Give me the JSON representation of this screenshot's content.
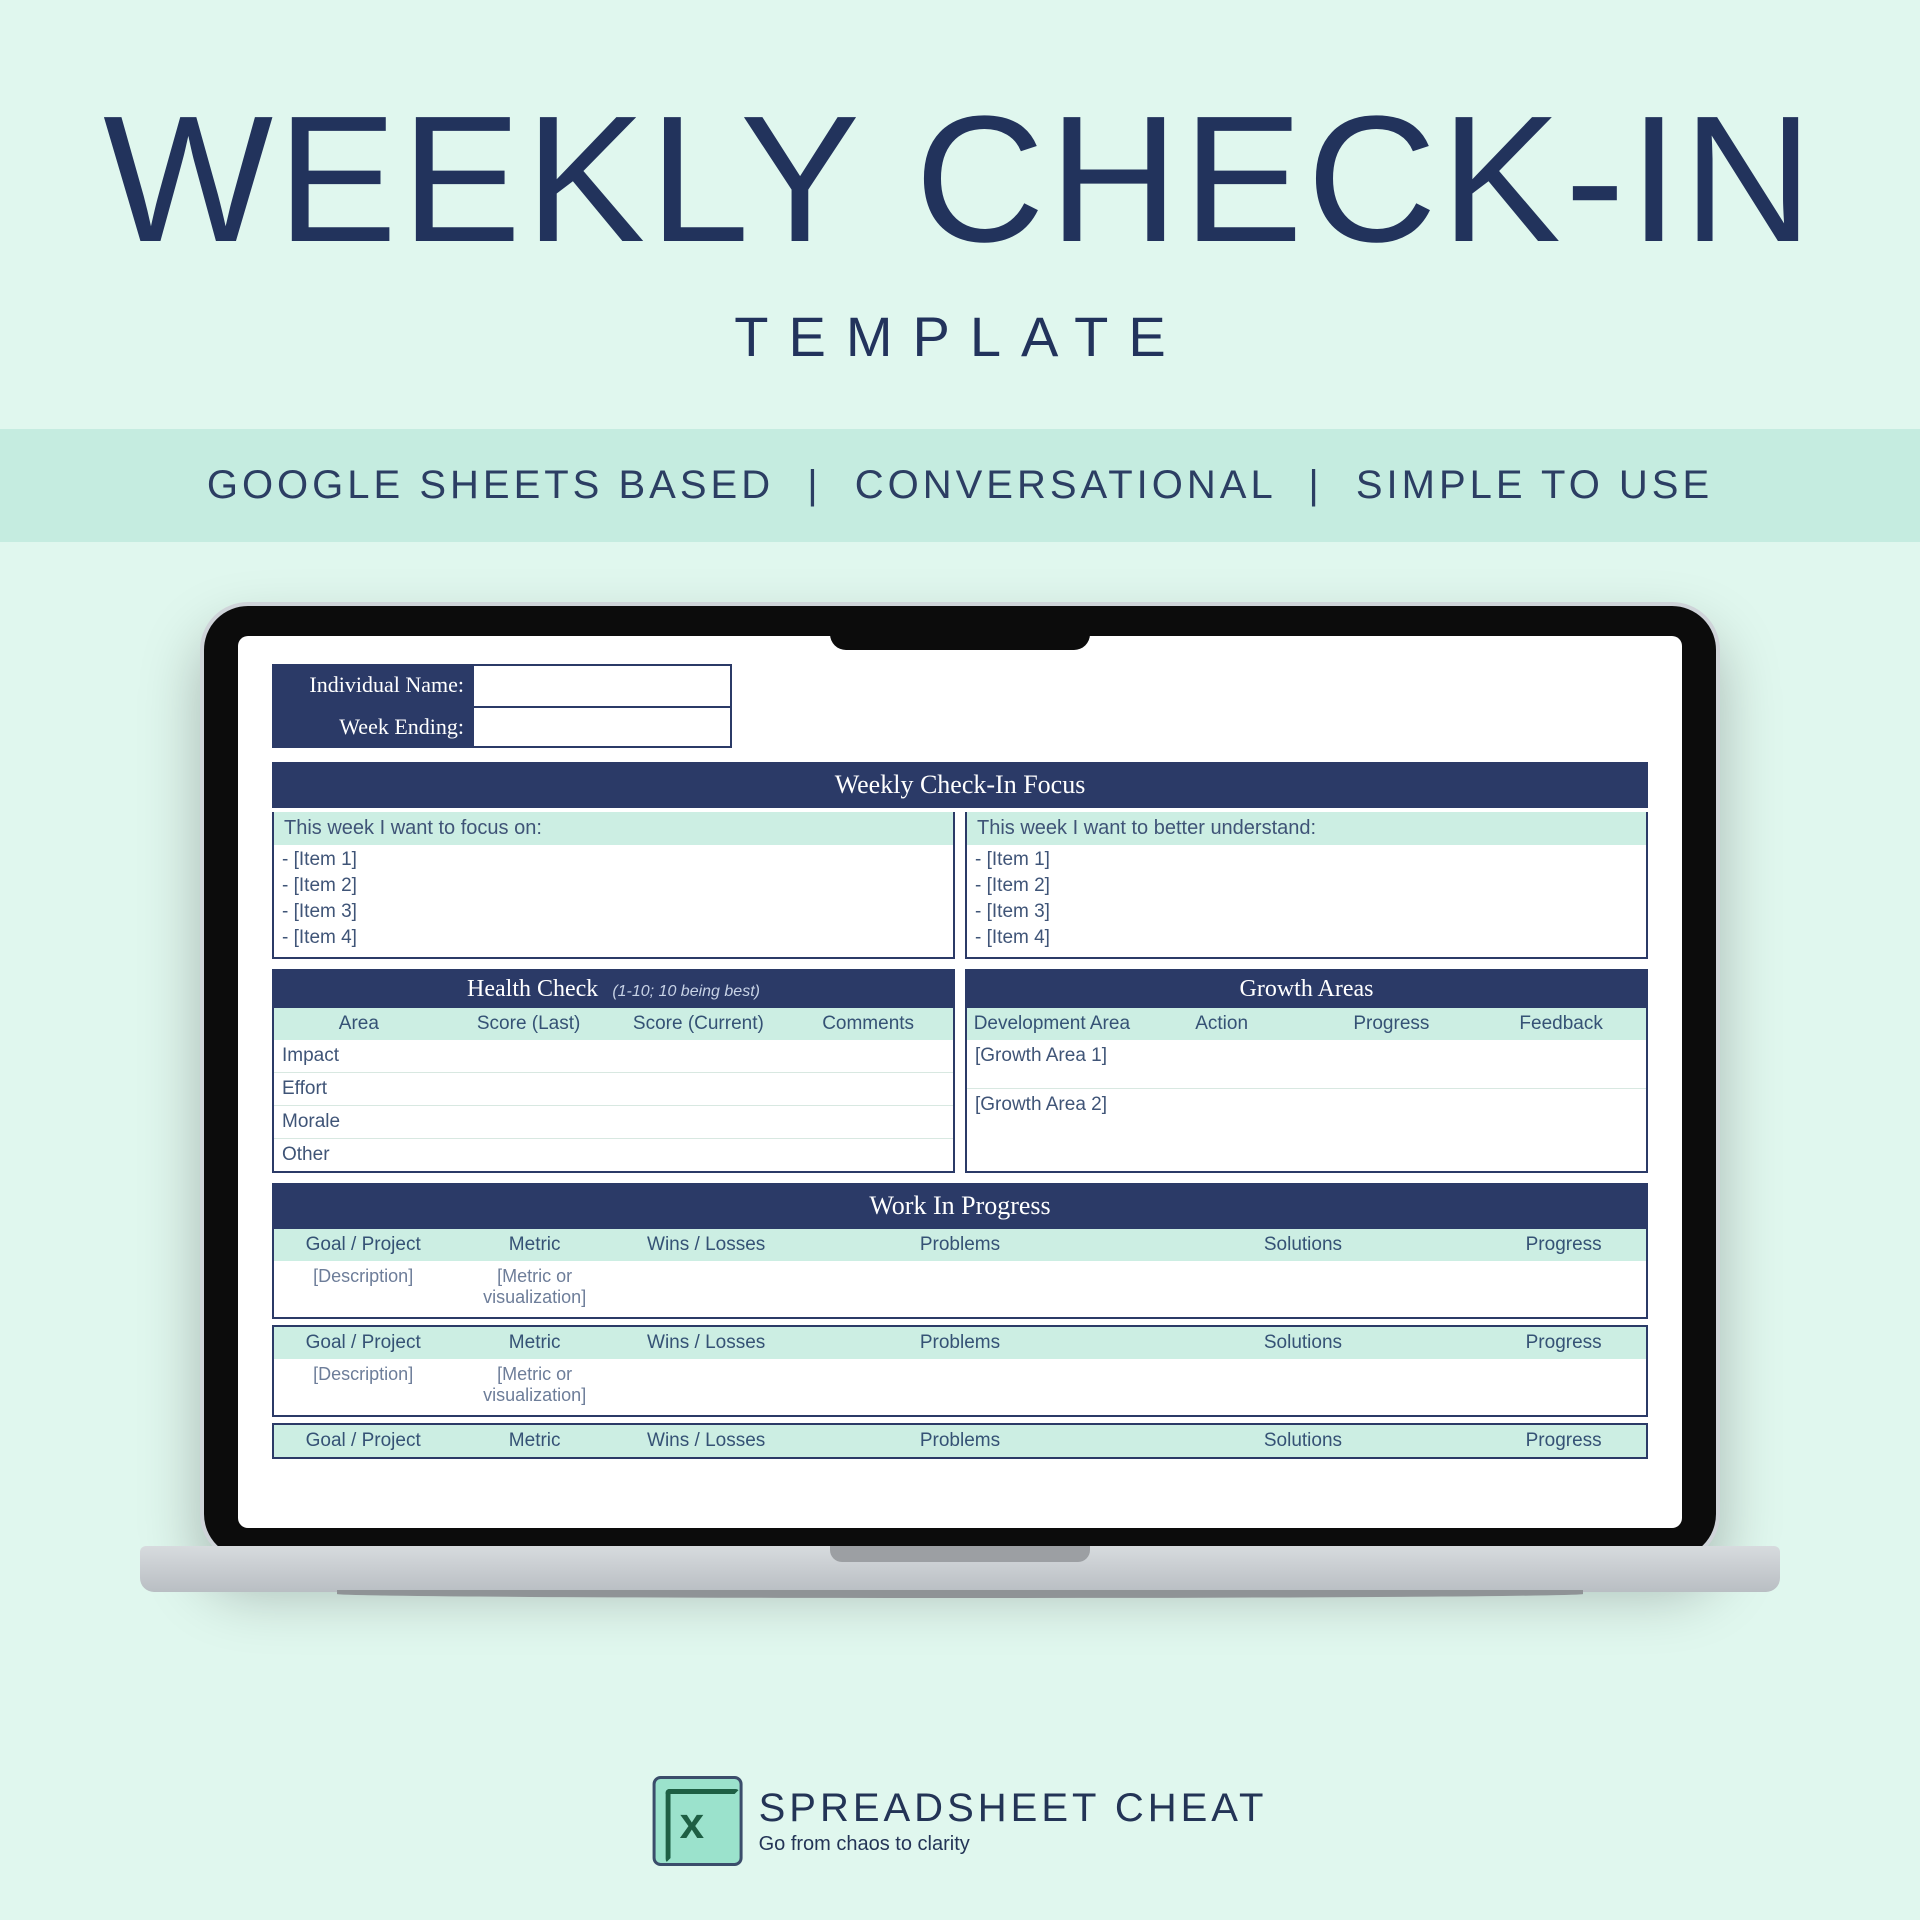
{
  "hero": {
    "title": "WEEKLY CHECK-IN",
    "subtitle": "TEMPLATE"
  },
  "features": {
    "items": [
      "GOOGLE SHEETS BASED",
      "CONVERSATIONAL",
      "SIMPLE TO USE"
    ],
    "separator": "|"
  },
  "sheet": {
    "fields": {
      "name_label": "Individual Name:",
      "week_label": "Week Ending:"
    },
    "focus": {
      "section_title": "Weekly Check-In Focus",
      "left_heading": "This week I want to focus on:",
      "right_heading": "This week I want to better understand:",
      "left_items": [
        "- [Item 1]",
        "- [Item 2]",
        "- [Item 3]",
        "- [Item 4]"
      ],
      "right_items": [
        "- [Item 1]",
        "- [Item 2]",
        "- [Item 3]",
        "- [Item 4]"
      ]
    },
    "health": {
      "title": "Health Check",
      "subtitle": "(1-10; 10 being best)",
      "columns": [
        "Area",
        "Score (Last)",
        "Score (Current)",
        "Comments"
      ],
      "rows": [
        "Impact",
        "Effort",
        "Morale",
        "Other"
      ]
    },
    "growth": {
      "title": "Growth Areas",
      "columns": [
        "Development Area",
        "Action",
        "Progress",
        "Feedback"
      ],
      "rows": [
        "[Growth Area 1]",
        "[Growth Area 2]"
      ]
    },
    "wip": {
      "title": "Work In Progress",
      "columns": [
        "Goal / Project",
        "Metric",
        "Wins / Losses",
        "Problems",
        "Solutions",
        "Progress"
      ],
      "row_desc": "[Description]",
      "row_metric": "[Metric or visualization]"
    }
  },
  "brand": {
    "name": "SPREADSHEET CHEAT",
    "tagline": "Go from chaos to clarity",
    "logo_letter": "x"
  }
}
